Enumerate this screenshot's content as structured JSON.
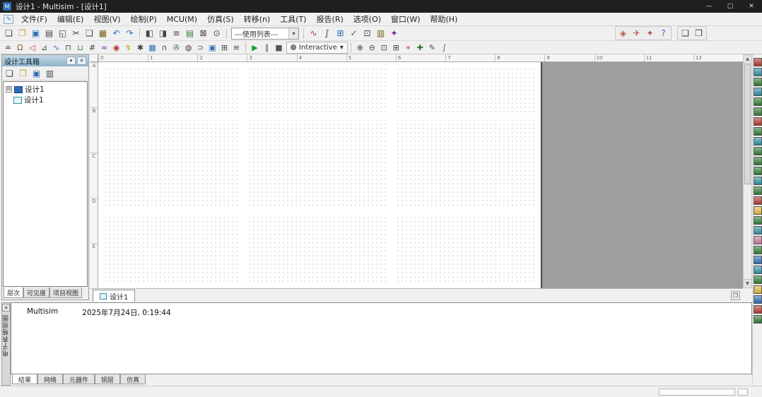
{
  "window": {
    "app_icon_glyph": "M",
    "title": "设计1 - Multisim - [设计1]",
    "controls": {
      "minimize": "—",
      "maximize": "▢",
      "close": "✕"
    }
  },
  "menubar": {
    "child_icon_glyph": "∿",
    "items": [
      "文件(F)",
      "编辑(E)",
      "视图(V)",
      "绘制(P)",
      "MCU(M)",
      "仿真(S)",
      "转移(n)",
      "工具(T)",
      "报告(R)",
      "选项(O)",
      "窗口(W)",
      "帮助(H)"
    ]
  },
  "toolbar_main": {
    "standard_icons": [
      {
        "name": "new-icon",
        "glyph": "❏",
        "color": "#444444"
      },
      {
        "name": "open-icon",
        "glyph": "❐",
        "color": "#c9a227"
      },
      {
        "name": "save-icon",
        "glyph": "▣",
        "color": "#2d6db5"
      },
      {
        "name": "print-icon",
        "glyph": "▤",
        "color": "#444444"
      },
      {
        "name": "print-preview-icon",
        "glyph": "◱",
        "color": "#444444"
      },
      {
        "name": "cut-icon",
        "glyph": "✂",
        "color": "#444444"
      },
      {
        "name": "copy-icon",
        "glyph": "❑",
        "color": "#444444"
      },
      {
        "name": "paste-icon",
        "glyph": "▦",
        "color": "#7a5c1e"
      },
      {
        "name": "undo-icon",
        "glyph": "↶",
        "color": "#2d6db5"
      },
      {
        "name": "redo-icon",
        "glyph": "↷",
        "color": "#2d6db5"
      }
    ],
    "view_icons": [
      {
        "name": "design-toolbox-toggle-icon",
        "glyph": "◧",
        "color": "#444444"
      },
      {
        "name": "spreadsheet-view-toggle-icon",
        "glyph": "◨",
        "color": "#444444"
      },
      {
        "name": "spice-netlist-viewer-icon",
        "glyph": "≡",
        "color": "#444444"
      },
      {
        "name": "ladder-diagram-icon",
        "glyph": "▤",
        "color": "#2e7d32"
      },
      {
        "name": "fullscreen-icon",
        "glyph": "⊠",
        "color": "#444444"
      },
      {
        "name": "zoom-full-icon",
        "glyph": "⊙",
        "color": "#444444"
      }
    ],
    "in_use_list": {
      "value": "---使用列表---",
      "dropdown_arrow": "▾"
    },
    "tool_icons": [
      {
        "name": "grapher-icon",
        "glyph": "∿",
        "color": "#b5352f"
      },
      {
        "name": "analyses-icon",
        "glyph": "∫",
        "color": "#444444"
      },
      {
        "name": "postprocessor-icon",
        "glyph": "⊞",
        "color": "#2d6db5"
      },
      {
        "name": "erc-icon",
        "glyph": "✓",
        "color": "#2e7d32"
      },
      {
        "name": "capture-area-icon",
        "glyph": "⊡",
        "color": "#444444"
      },
      {
        "name": "database-manager-icon",
        "glyph": "▥",
        "color": "#7a5c1e"
      },
      {
        "name": "component-wizard-icon",
        "glyph": "✦",
        "color": "#7b1fa2"
      }
    ],
    "right_icons": [
      {
        "name": "find-examples-icon",
        "glyph": "◈",
        "color": "#b5534d"
      },
      {
        "name": "education-website-icon",
        "glyph": "✈",
        "color": "#b5534d"
      },
      {
        "name": "ni-community-icon",
        "glyph": "✦",
        "color": "#b5534d"
      },
      {
        "name": "help-icon",
        "glyph": "?",
        "color": "#2d6db5"
      }
    ],
    "window_icons": [
      {
        "name": "new-window-icon",
        "glyph": "❏",
        "color": "#444444"
      },
      {
        "name": "window-layout-icon",
        "glyph": "❐",
        "color": "#444444"
      }
    ]
  },
  "toolbar_components": {
    "component_icons": [
      {
        "name": "place-source-icon",
        "glyph": "≐",
        "color": "#444444"
      },
      {
        "name": "place-basic-icon",
        "glyph": "Ω",
        "color": "#7a5c1e"
      },
      {
        "name": "place-diode-icon",
        "glyph": "◁",
        "color": "#b5352f"
      },
      {
        "name": "place-transistor-icon",
        "glyph": "⊿",
        "color": "#444444"
      },
      {
        "name": "place-analog-icon",
        "glyph": "∿",
        "color": "#2d6db5"
      },
      {
        "name": "place-ttl-icon",
        "glyph": "⊓",
        "color": "#444444"
      },
      {
        "name": "place-cmos-icon",
        "glyph": "⊔",
        "color": "#2e7d32"
      },
      {
        "name": "place-misc-digital-icon",
        "glyph": "#",
        "color": "#444444"
      },
      {
        "name": "place-mixed-icon",
        "glyph": "≈",
        "color": "#7b1fa2"
      },
      {
        "name": "place-indicator-icon",
        "glyph": "◉",
        "color": "#b5352f"
      },
      {
        "name": "place-power-icon",
        "glyph": "↯",
        "color": "#c9a227"
      },
      {
        "name": "place-misc-icon",
        "glyph": "✱",
        "color": "#444444"
      },
      {
        "name": "place-advanced-peripherals-icon",
        "glyph": "▦",
        "color": "#2d6db5"
      },
      {
        "name": "place-rf-icon",
        "glyph": "∩",
        "color": "#444444"
      },
      {
        "name": "place-electromechanical-icon",
        "glyph": "✇",
        "color": "#2e7d32"
      },
      {
        "name": "place-ncs-icon",
        "glyph": "◍",
        "color": "#444444"
      },
      {
        "name": "place-connector-icon",
        "glyph": "⊃",
        "color": "#444444"
      },
      {
        "name": "place-mcu-icon",
        "glyph": "▣",
        "color": "#2d6db5"
      },
      {
        "name": "place-hierarchical-block-icon",
        "glyph": "⊞",
        "color": "#444444"
      },
      {
        "name": "place-bus-icon",
        "glyph": "≡",
        "color": "#444444"
      }
    ],
    "simulation": {
      "run_icon": "▶",
      "pause_icon": "∥",
      "stop_icon": "■",
      "interactive_label": "Interactive",
      "dropdown_arrow": "▾",
      "run_color": "#0f9d2a"
    },
    "zoom_icons": [
      {
        "name": "zoom-in-icon",
        "glyph": "⊕",
        "color": "#444444"
      },
      {
        "name": "zoom-out-icon",
        "glyph": "⊖",
        "color": "#444444"
      },
      {
        "name": "zoom-area-icon",
        "glyph": "⊡",
        "color": "#444444"
      },
      {
        "name": "zoom-sheet-icon",
        "glyph": "⊞",
        "color": "#444444"
      },
      {
        "name": "probe-icon",
        "glyph": "⌖",
        "color": "#b5352f"
      },
      {
        "name": "probe-settings-icon",
        "glyph": "✚",
        "color": "#2e7d32"
      },
      {
        "name": "simulation-settings-icon",
        "glyph": "✎",
        "color": "#444444"
      },
      {
        "name": "analyses-and-simulation-icon",
        "glyph": "∫",
        "color": "#2d6db5"
      }
    ]
  },
  "design_toolbox": {
    "title": "设计工具箱",
    "header_buttons": {
      "menu": "▾",
      "close": "✕"
    },
    "toolbar_icons": [
      {
        "name": "new-design-icon",
        "glyph": "❏",
        "color": "#444444"
      },
      {
        "name": "open-design-icon",
        "glyph": "❐",
        "color": "#c9a227"
      },
      {
        "name": "save-design-icon",
        "glyph": "▣",
        "color": "#2d6db5"
      },
      {
        "name": "close-design-icon",
        "glyph": "▥",
        "color": "#444444"
      }
    ],
    "tree": {
      "root_expander": "⊟",
      "root_label": "设计1",
      "child_label": "设计1"
    },
    "tabs": [
      "层次",
      "可见度",
      "项目视图"
    ]
  },
  "workspace": {
    "hruler_labels": [
      "0",
      "1",
      "2",
      "3",
      "4",
      "5",
      "6",
      "7",
      "8",
      "9",
      "10",
      "11",
      "12"
    ],
    "vruler_labels": [
      "A",
      "B",
      "C",
      "D",
      "E"
    ],
    "scrollbar": {
      "up": "▲",
      "down": "▼"
    }
  },
  "sheet_tabs": {
    "active": "设计1",
    "corner_button_glyph": "❐"
  },
  "spreadsheet": {
    "side_label": "电子表格视图",
    "close": "✕",
    "log": {
      "app": "Multisim",
      "timestamp": "2025年7月24日, 0:19:44"
    },
    "tabs": [
      "结果",
      "网络",
      "元器件",
      "铜层",
      "仿真"
    ]
  },
  "instruments": [
    {
      "name": "multimeter-icon",
      "color": "#b5352f"
    },
    {
      "name": "function-generator-icon",
      "color": "#2e8fa3"
    },
    {
      "name": "wattmeter-icon",
      "color": "#2e7d32"
    },
    {
      "name": "oscilloscope-icon",
      "color": "#2e8fa3"
    },
    {
      "name": "four-channel-oscilloscope-icon",
      "color": "#2e7d32"
    },
    {
      "name": "bode-plotter-icon",
      "color": "#2e7d32"
    },
    {
      "name": "frequency-counter-icon",
      "color": "#b5352f"
    },
    {
      "name": "word-generator-icon",
      "color": "#2e7d32"
    },
    {
      "name": "logic-converter-icon",
      "color": "#2e8fa3"
    },
    {
      "name": "logic-analyzer-icon",
      "color": "#2e7d32"
    },
    {
      "name": "iv-analyzer-icon",
      "color": "#2e7d32"
    },
    {
      "name": "distortion-analyzer-icon",
      "color": "#2e7d32"
    },
    {
      "name": "spectrum-analyzer-icon",
      "color": "#2e8fa3"
    },
    {
      "name": "network-analyzer-icon",
      "color": "#2e7d32"
    },
    {
      "name": "agilent-function-generator-icon",
      "color": "#b5352f"
    },
    {
      "name": "agilent-multimeter-icon",
      "color": "#e0b73a"
    },
    {
      "name": "agilent-oscilloscope-icon",
      "color": "#2e7d32"
    },
    {
      "name": "tektronix-oscilloscope-icon",
      "color": "#2e8fa3"
    },
    {
      "name": "labview-microphone-icon",
      "color": "#c77b9b"
    },
    {
      "name": "labview-speaker-icon",
      "color": "#2e7d32"
    },
    {
      "name": "labview-signal-analyzer-icon",
      "color": "#2d6db5"
    },
    {
      "name": "labview-signal-generator-icon",
      "color": "#2e8fa3"
    },
    {
      "name": "labview-streaming-generator-icon",
      "color": "#2e7d32"
    },
    {
      "name": "ni-elvismx-instruments-icon",
      "color": "#e0b73a"
    },
    {
      "name": "current-clamp-icon",
      "color": "#2d6db5"
    },
    {
      "name": "measurement-probe-icon",
      "color": "#b5352f"
    },
    {
      "name": "preset-measurement-probes-icon",
      "color": "#2e7d32"
    }
  ],
  "colors": {
    "titlebar_bg": "#1f1f1f",
    "toolbar_bg": "#f0f0f0",
    "outside_page_gray": "#9e9e9e",
    "run_green": "#0f9d2a",
    "toolbox_header_blue": "#8fb3ca",
    "sheet_border": "#4a4a4a"
  }
}
